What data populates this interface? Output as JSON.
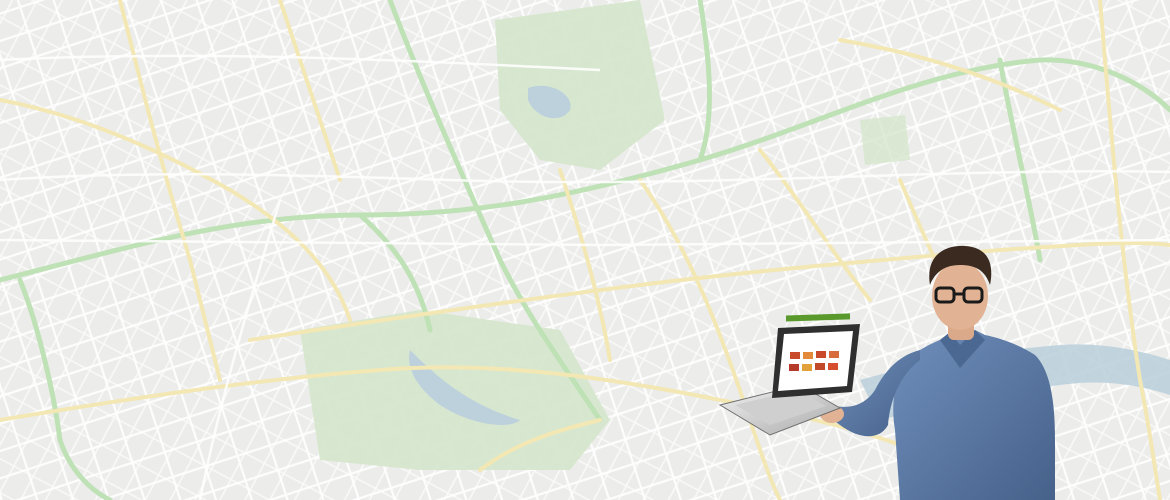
{
  "hero": {
    "colors": {
      "map_background": "#ececea",
      "road_minor": "#ffffff",
      "road_major": "#f3e7b3",
      "road_trunk": "#bfe1b6",
      "park": "#d6e7cd",
      "water": "#bdd1dd",
      "laptop_screen_accent": "#5a9a2c",
      "shirt": "#5a7ba6"
    }
  }
}
